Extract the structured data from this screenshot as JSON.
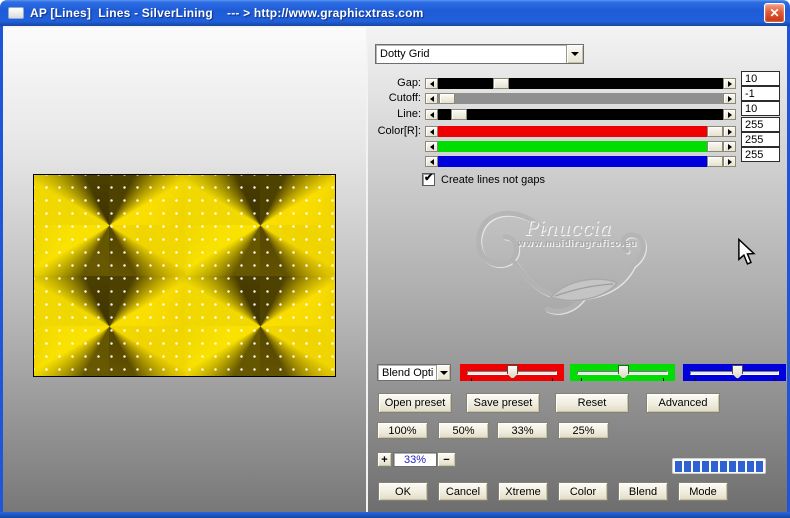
{
  "titlebar": {
    "title": "AP [Lines]  Lines - SilverLining    --- > http://www.graphicxtras.com",
    "close_glyph": "✕"
  },
  "pattern_dropdown": {
    "value": "Dotty Grid"
  },
  "param_sliders": {
    "rows": [
      {
        "label": "Gap:",
        "value": "10"
      },
      {
        "label": "Cutoff:",
        "value": "-1"
      },
      {
        "label": "Line:",
        "value": "10"
      },
      {
        "label": "Color[R]:",
        "value": "255"
      },
      {
        "label": "",
        "value": "255"
      },
      {
        "label": "",
        "value": "255"
      }
    ]
  },
  "checkbox": {
    "label": "Create lines not gaps",
    "checked": true,
    "glyph": "✔"
  },
  "watermark": {
    "name": "Pinuccia",
    "url": "www.maidiragrafico.eu"
  },
  "blend_dropdown": {
    "value": "Blend Opti"
  },
  "preset_buttons": {
    "open": "Open preset",
    "save": "Save preset",
    "reset": "Reset",
    "advanced": "Advanced"
  },
  "zoom_buttons": {
    "b100": "100%",
    "b50": "50%",
    "b33": "33%",
    "b25": "25%"
  },
  "zoom_control": {
    "plus": "+",
    "value": "33%",
    "minus": "−"
  },
  "progress": {
    "segments": 10,
    "color": "#2e62d0"
  },
  "action_buttons": {
    "ok": "OK",
    "cancel": "Cancel",
    "xtreme": "Xtreme",
    "color": "Color",
    "blend": "Blend",
    "mode": "Mode"
  },
  "colors": {
    "titlebar_blue": "#1e56d6",
    "track_black": "#000000",
    "track_gray": "#909090",
    "slider_red": "#ee0000",
    "slider_green": "#00dd00",
    "slider_blue": "#0000dd"
  }
}
